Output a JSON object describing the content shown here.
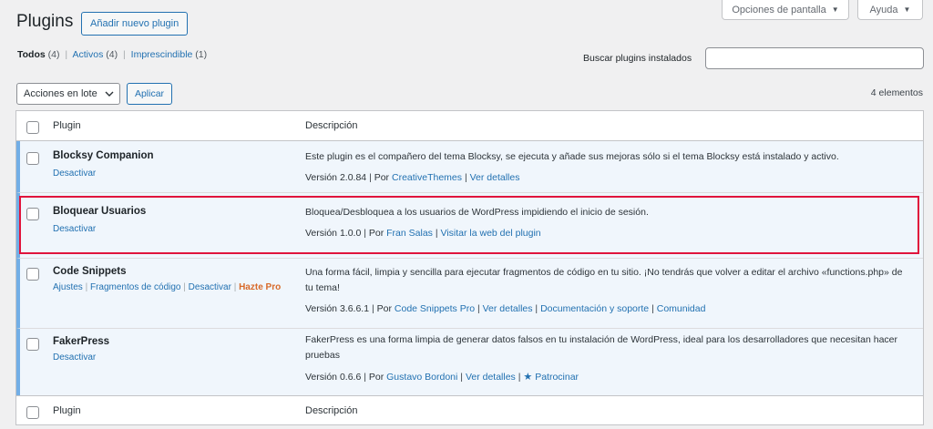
{
  "header": {
    "title": "Plugins",
    "add_new": "Añadir nuevo plugin",
    "screen_options": "Opciones de pantalla",
    "help": "Ayuda"
  },
  "filters": {
    "all": "Todos",
    "all_count": "(4)",
    "active": "Activos",
    "active_count": "(4)",
    "mustuse": "Imprescindible",
    "mustuse_count": "(1)"
  },
  "search": {
    "label": "Buscar plugins instalados",
    "value": ""
  },
  "bulk": {
    "selected": "Acciones en lote",
    "apply": "Aplicar",
    "items_count": "4 elementos"
  },
  "table": {
    "col_plugin": "Plugin",
    "col_desc": "Descripción",
    "plugins": [
      {
        "name": "Blocksy Companion",
        "actions": [
          "Desactivar"
        ],
        "description": "Este plugin es el compañero del tema Blocksy, se ejecuta y añade sus mejoras sólo si el tema Blocksy está instalado y activo.",
        "version": "Versión 2.0.84",
        "by": "Por",
        "author": "CreativeThemes",
        "links": [
          "Ver detalles"
        ]
      },
      {
        "name": "Bloquear Usuarios",
        "actions": [
          "Desactivar"
        ],
        "description": "Bloquea/Desbloquea a los usuarios de WordPress impidiendo el inicio de sesión.",
        "version": "Versión 1.0.0",
        "by": "Por",
        "author": "Fran Salas",
        "links": [
          "Visitar la web del plugin"
        ]
      },
      {
        "name": "Code Snippets",
        "actions": [
          "Ajustes",
          "Fragmentos de código",
          "Desactivar"
        ],
        "pro_action": "Hazte Pro",
        "description": "Una forma fácil, limpia y sencilla para ejecutar fragmentos de código en tu sitio. ¡No tendrás que volver a editar el archivo «functions.php» de tu tema!",
        "version": "Versión 3.6.6.1",
        "by": "Por",
        "author": "Code Snippets Pro",
        "links": [
          "Ver detalles",
          "Documentación y soporte",
          "Comunidad"
        ]
      },
      {
        "name": "FakerPress",
        "actions": [
          "Desactivar"
        ],
        "description": "FakerPress es una forma limpia de generar datos falsos en tu instalación de WordPress, ideal para los desarrolladores que necesitan hacer pruebas",
        "version": "Versión 0.6.6",
        "by": "Por",
        "author": "Gustavo Bordoni",
        "links": [
          "Ver detalles",
          "Patrocinar"
        ]
      }
    ]
  },
  "colors": {
    "accent": "#2271b1",
    "active_bar": "#72aee6",
    "highlight": "#e0143c",
    "pro": "#d86a2a"
  }
}
